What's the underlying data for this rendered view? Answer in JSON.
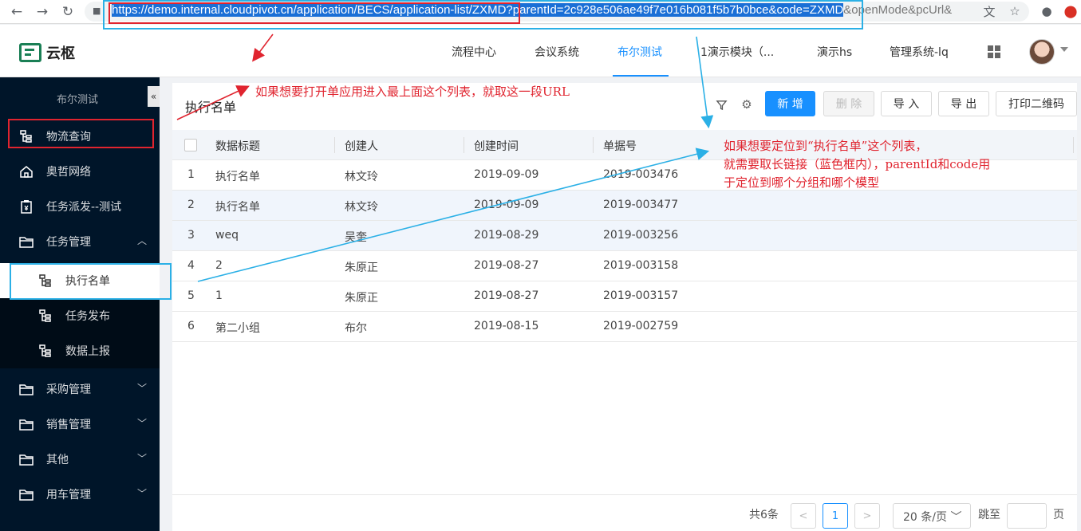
{
  "browser": {
    "url_selected": "https://demo.internal.cloudpivot.cn/application/BECS/application-list/ZXMD",
    "url_query": "?parentId=2c928e506ae49f7e016b081f5b7b0bce&code=ZXMD",
    "url_rest": "&openMode&pcUrl&"
  },
  "header": {
    "logo_text": "云枢",
    "nav": [
      "流程中心",
      "会议系统",
      "布尔测试",
      "1演示模块（...",
      "演示hs",
      "管理系统-lq"
    ],
    "active_nav": "布尔测试"
  },
  "sidebar": {
    "title": "布尔测试",
    "collapse_glyph": "«",
    "items": [
      {
        "label": "物流查询",
        "icon": "tree-icon"
      },
      {
        "label": "奥哲网络",
        "icon": "home-icon"
      },
      {
        "label": "任务派发--测试",
        "icon": "clipboard-icon"
      },
      {
        "label": "任务管理",
        "icon": "folder-icon"
      }
    ],
    "subitems": [
      {
        "label": "执行名单",
        "icon": "tree-icon"
      },
      {
        "label": "任务发布",
        "icon": "tree-icon"
      },
      {
        "label": "数据上报",
        "icon": "tree-icon"
      }
    ],
    "groups": [
      {
        "label": "采购管理",
        "icon": "folder-icon"
      },
      {
        "label": "销售管理",
        "icon": "folder-icon"
      },
      {
        "label": "其他",
        "icon": "folder-icon"
      },
      {
        "label": "用车管理",
        "icon": "folder-icon"
      }
    ]
  },
  "page": {
    "title": "执行名单",
    "buttons": {
      "add": "新 增",
      "delete": "删 除",
      "import": "导 入",
      "export": "导 出",
      "print_qr": "打印二维码"
    }
  },
  "table": {
    "columns": [
      "数据标题",
      "创建人",
      "创建时间",
      "单据号"
    ],
    "rows": [
      {
        "idx": "1",
        "title": "执行名单",
        "creator": "林文玲",
        "date": "2019-09-09",
        "no": "2019-003476"
      },
      {
        "idx": "2",
        "title": "执行名单",
        "creator": "林文玲",
        "date": "2019-09-09",
        "no": "2019-003477"
      },
      {
        "idx": "3",
        "title": "weq",
        "creator": "吴奎",
        "date": "2019-08-29",
        "no": "2019-003256"
      },
      {
        "idx": "4",
        "title": "2",
        "creator": "朱原正",
        "date": "2019-08-27",
        "no": "2019-003158"
      },
      {
        "idx": "5",
        "title": "1",
        "creator": "朱原正",
        "date": "2019-08-27",
        "no": "2019-003157"
      },
      {
        "idx": "6",
        "title": "第二小组",
        "creator": "布尔",
        "date": "2019-08-15",
        "no": "2019-002759"
      }
    ]
  },
  "pager": {
    "total": "共6条",
    "prev": "<",
    "current": "1",
    "next": ">",
    "page_size": "20 条/页",
    "jump_to": "跳至",
    "page_unit": "页"
  },
  "annotations": {
    "note1": "如果想要打开单应用进入最上面这个列表，就取这一段URL",
    "note2_lines": [
      "如果想要定位到“执行名单”这个列表，",
      "就需要取长链接（蓝色框内），parentId和code用",
      "于定位到哪个分组和哪个模型"
    ]
  },
  "colors": {
    "primary": "#1890ff",
    "sidebar": "#001529",
    "annotation_red": "#e0242f",
    "annotation_blue": "#2bb0e6"
  }
}
